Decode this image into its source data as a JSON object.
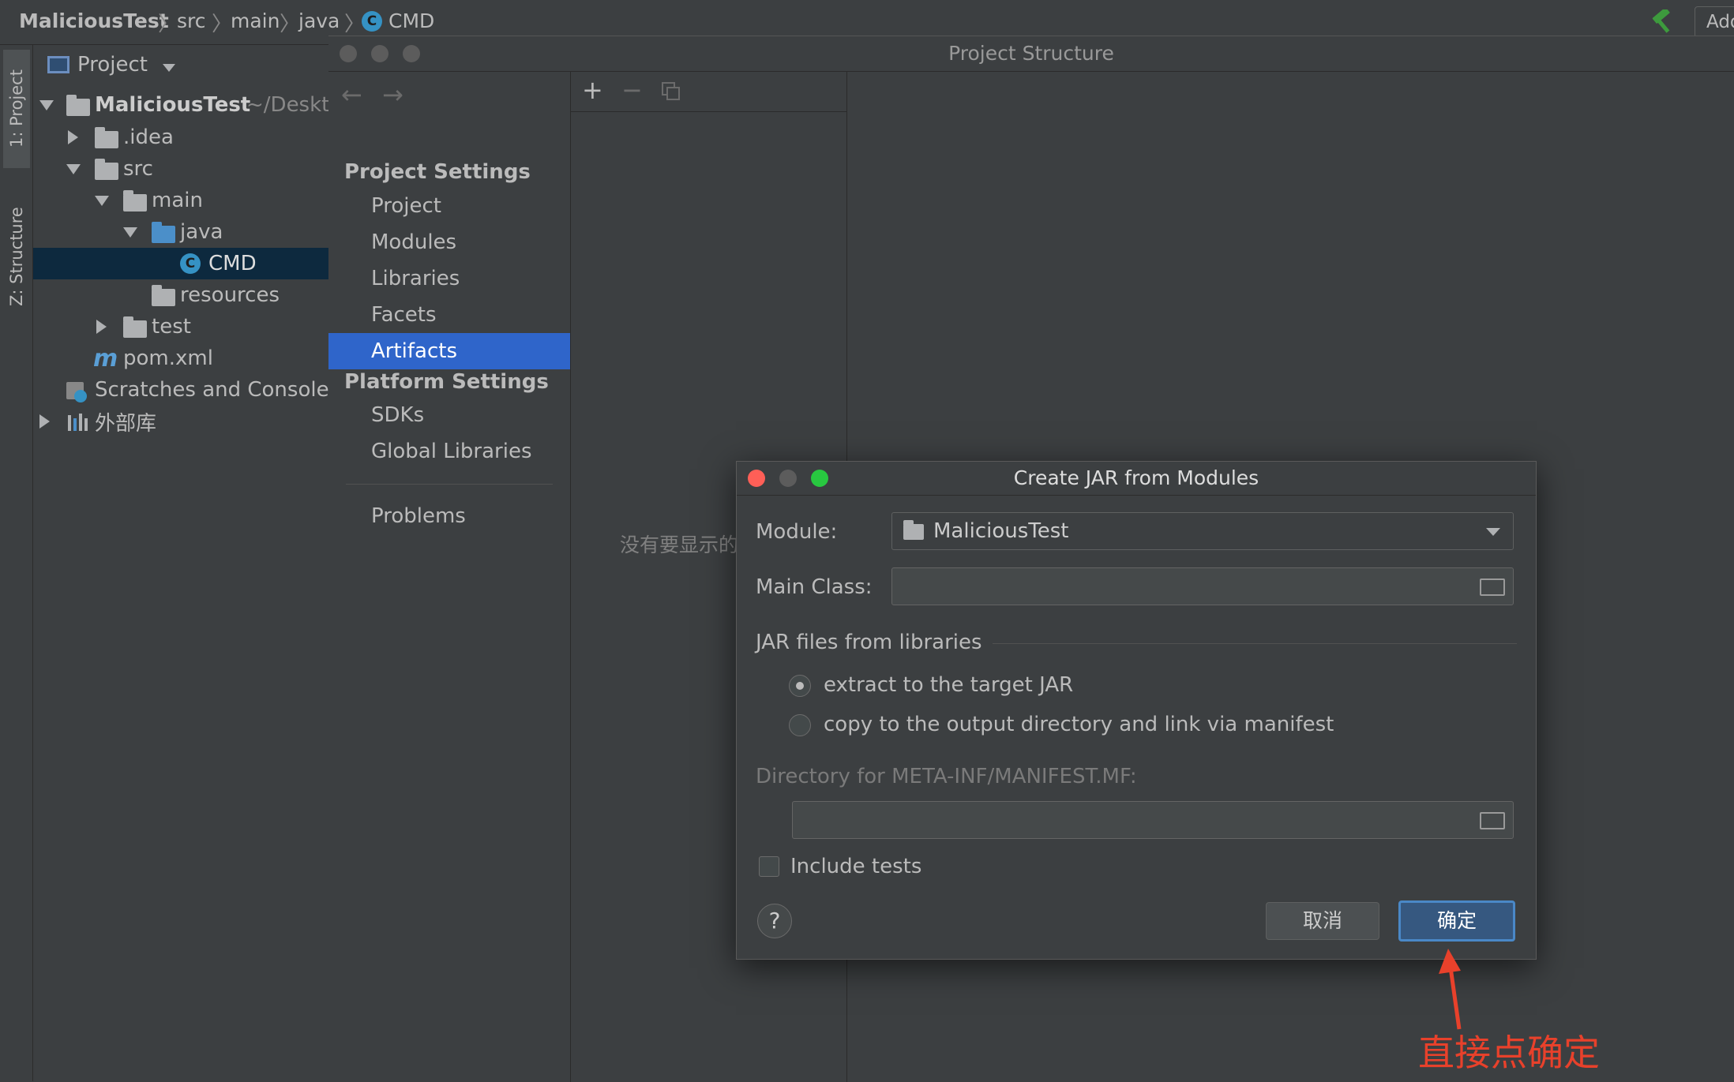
{
  "breadcrumb": {
    "items": [
      "MaliciousTest",
      "src",
      "main",
      "java",
      "CMD"
    ],
    "run_button_label": "Add"
  },
  "toolstrip": {
    "project_tab": "1: Project",
    "structure_tab": "Z: Structure"
  },
  "project_panel": {
    "header": "Project",
    "root": {
      "label": "MaliciousTest",
      "path": "~/Deskt"
    },
    "items": {
      "idea": ".idea",
      "src": "src",
      "main": "main",
      "java": "java",
      "cmd": "CMD",
      "resources": "resources",
      "test": "test",
      "pom": "pom.xml",
      "scratches": "Scratches and Consoles",
      "external": "外部库"
    },
    "class_icon_letter": "C",
    "maven_icon_letter": "m"
  },
  "project_structure": {
    "title": "Project Structure",
    "project_settings_header": "Project Settings",
    "project_settings_items": [
      "Project",
      "Modules",
      "Libraries",
      "Facets",
      "Artifacts"
    ],
    "platform_settings_header": "Platform Settings",
    "platform_settings_items": [
      "SDKs",
      "Global Libraries"
    ],
    "problems": "Problems",
    "selected_item": "Artifacts",
    "empty_text": "没有要显示的"
  },
  "jar_dialog": {
    "title": "Create JAR from Modules",
    "module_label": "Module:",
    "module_value": "MaliciousTest",
    "main_class_label": "Main Class:",
    "main_class_value": "",
    "jar_files_label": "JAR files from libraries",
    "option_extract": "extract to the target JAR",
    "option_copy": "copy to the output directory and link via manifest",
    "selected_option": "extract",
    "manifest_dir_label": "Directory for META-INF/MANIFEST.MF:",
    "manifest_dir_value": "",
    "include_tests_label": "Include tests",
    "include_tests_checked": false,
    "help_label": "?",
    "cancel_label": "取消",
    "ok_label": "确定"
  },
  "annotation": {
    "text": "直接点确定",
    "color": "#e8412b"
  },
  "colors": {
    "background": "#3c3f41",
    "selection": "#2f65ca",
    "tree_selection": "#0d293e",
    "primary_button": "#365880",
    "close_dot": "#ff5f57",
    "minimize_dot": "#5c5c5c",
    "zoom_dot": "#28c840",
    "hammer": "#3d9a3d"
  }
}
